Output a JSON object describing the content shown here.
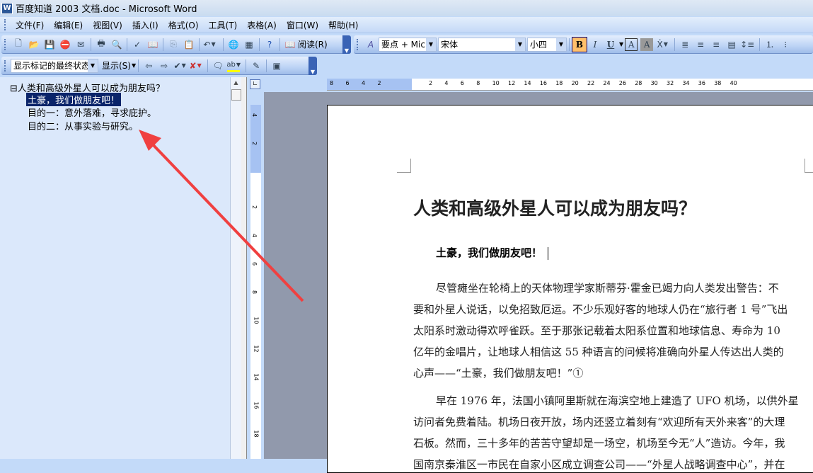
{
  "window": {
    "title": "百度知道 2003 文档.doc - Microsoft Word",
    "app_icon": "W"
  },
  "menu": [
    "文件(F)",
    "编辑(E)",
    "视图(V)",
    "插入(I)",
    "格式(O)",
    "工具(T)",
    "表格(A)",
    "窗口(W)",
    "帮助(H)"
  ],
  "toolbar": {
    "read_label": "阅读(R)",
    "style": "要点 + Mic",
    "font": "宋体",
    "size": "小四",
    "bold": "B",
    "italic": "I",
    "underline": "U",
    "char_border": "A",
    "char_shading": "A"
  },
  "review_toolbar": {
    "display_state": "显示标记的最终状态",
    "show_label": "显示(S)"
  },
  "doc_map": {
    "items": [
      "⊟人类和高级外星人可以成为朋友吗？",
      "土豪，我们做朋友吧！",
      "目的一：意外落难，寻求庇护。",
      "目的二：从事实验与研究。"
    ]
  },
  "rulers": {
    "h_labels": [
      "8",
      "6",
      "4",
      "2",
      "2",
      "4",
      "6",
      "8",
      "10",
      "12",
      "14",
      "16",
      "18",
      "20",
      "22",
      "24",
      "26",
      "28",
      "30",
      "32",
      "34",
      "36",
      "38",
      "40"
    ],
    "v_labels": [
      "4",
      "2",
      "2",
      "4",
      "6",
      "8",
      "10",
      "12",
      "14",
      "16",
      "18"
    ]
  },
  "document": {
    "title": "人类和高级外星人可以成为朋友吗？",
    "subtitle": "土豪，我们做朋友吧！",
    "para1": [
      "尽管瘫坐在轮椅上的天体物理学家斯蒂芬·霍金已竭力向人类发出警告：不",
      "要和外星人说话，以免招致厄运。不少乐观好客的地球人仍在“旅行者 1 号”飞出",
      "太阳系时激动得欢呼雀跃。至于那张记载着太阳系位置和地球信息、寿命为 10",
      "亿年的金唱片，让地球人相信这 55 种语言的问候将准确向外星人传达出人类的",
      "心声——“土豪，我们做朋友吧！”①"
    ],
    "para2": [
      "早在 1976 年，法国小镇阿里斯就在海滨空地上建造了 UFO 机场，以供外星",
      "访问者免费着陆。机场日夜开放，场内还竖立着刻有“欢迎所有天外来客”的大理",
      "石板。然而，三十多年的苦苦守望却是一场空，机场至今无“人”造访。今年，我",
      "国南京秦淮区一市民在自家小区成立调查公司——“外星人战略调查中心”，并在"
    ]
  },
  "colors": {
    "annotation_arrow": "#f04040",
    "selection": "#0a246a",
    "workspace": "#9199ac"
  }
}
